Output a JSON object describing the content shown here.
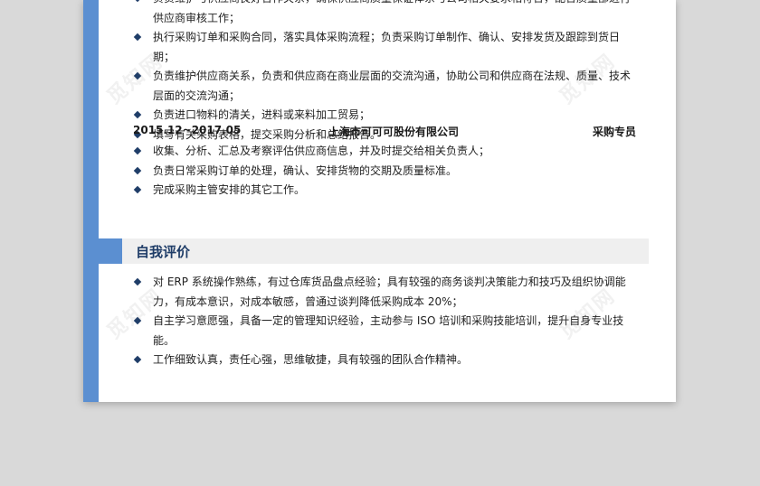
{
  "block1": {
    "items": [
      "负责维护与供应商良好合作关系，确保供应商质量保证体系与公司相关要求相符合，配合质量部进行供应商审核工作；",
      "执行采购订单和采购合同，落实具体采购流程；负责采购订单制作、确认、安排发货及跟踪到货日期；",
      "负责维护供应商关系，负责和供应商在商业层面的交流沟通，协助公司和供应商在法规、质量、技术层面的交流沟通；",
      "负责进口物料的清关，进料或来料加工贸易；",
      "填写有关采购表格，提交采购分析和总结报告。"
    ]
  },
  "job2": {
    "date": "2015.12~2017.05",
    "company": "上海市可可可股份有限公司",
    "role": "采购专员",
    "items": [
      "收集、分析、汇总及考察评估供应商信息，并及时提交给相关负责人；",
      "负责日常采购订单的处理，确认、安排货物的交期及质量标准。",
      "完成采购主管安排的其它工作。"
    ]
  },
  "self_eval": {
    "title": "自我评价",
    "items": [
      "对 ERP 系统操作熟练，有过仓库货品盘点经验；具有较强的商务谈判决策能力和技巧及组织协调能力，有成本意识，对成本敏感，曾通过谈判降低采购成本 20%；",
      "自主学习意愿强，具备一定的管理知识经验，主动参与 ISO 培训和采购技能培训，提升自身专业技能。",
      "工作细致认真，责任心强，思维敏捷，具有较强的团队合作精神。"
    ]
  },
  "watermark": "觅知网",
  "colors": {
    "accent": "#5b8fd1",
    "heading": "#1f3d68",
    "section_bg": "#efefef"
  }
}
